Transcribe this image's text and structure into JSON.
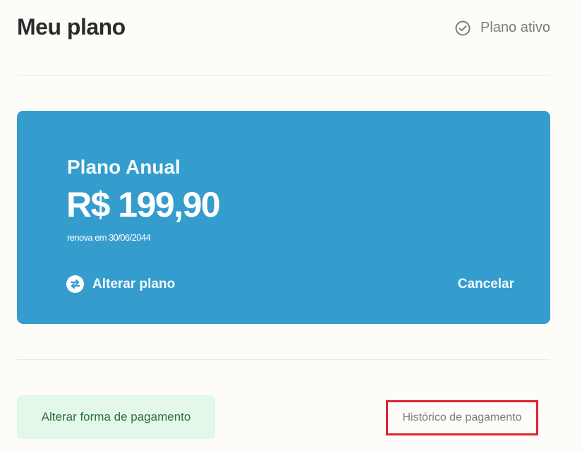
{
  "header": {
    "title": "Meu plano",
    "status_label": "Plano ativo",
    "status_icon": "check-circle-icon"
  },
  "plan": {
    "name": "Plano Anual",
    "price": "R$ 199,90",
    "renewal": "renova em 30/06/2044",
    "change_label": "Alterar plano",
    "change_icon": "swap-arrows-icon",
    "cancel_label": "Cancelar",
    "card_color": "#359dce"
  },
  "footer": {
    "payment_method_label": "Alterar forma de pagamento",
    "payment_history_label": "Histórico de pagamento"
  },
  "colors": {
    "background": "#fdfcf8",
    "accent_blue": "#359dce",
    "success_bg": "#e3f8e8",
    "success_text": "#2f6d3c",
    "highlight_border": "#e02231"
  }
}
